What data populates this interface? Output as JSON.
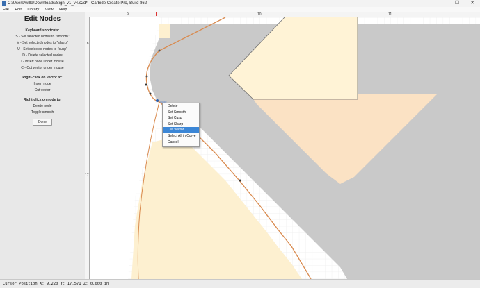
{
  "window": {
    "title": "C:/Users/willa/Downloads/Sign_v1_v4.c2d* - Carbide Create Pro, Build 862",
    "minimize_glyph": "—",
    "maximize_glyph": "☐",
    "close_glyph": "✕"
  },
  "menu": [
    "File",
    "Edit",
    "Library",
    "View",
    "Help"
  ],
  "panel": {
    "heading": "Edit Nodes",
    "shortcuts_title": "Keyboard shortcuts:",
    "shortcuts": [
      "S - Set selected nodes to \"smooth\"",
      "V - Set selected nodes to \"sharp\"",
      "U - Set selected nodes to \"cusp\"",
      "D - Delete selected nodes",
      "I - Insert node under mouse",
      "C - Cut vector under mouse"
    ],
    "vector_title": "Right-click on vector to:",
    "vector_actions": [
      "Insert node",
      "Cut vector"
    ],
    "node_title": "Right-click on node to:",
    "node_actions": [
      "Delete node",
      "Toggle smooth"
    ],
    "done_label": "Done"
  },
  "rulers": {
    "top_labels": [
      "9",
      "10",
      "11"
    ],
    "left_labels": [
      "18",
      "17"
    ]
  },
  "context_menu": {
    "items": [
      "Delete",
      "Set Smooth",
      "Set Cusp",
      "Set Sharp",
      "Cut Vector",
      "Select All in Curve",
      "Cancel"
    ],
    "selected_index": 4
  },
  "node_tag": "Node",
  "status": {
    "text": "Cursor Position X: 9.220 Y: 17.571 Z: 0.000 in"
  },
  "colors": {
    "accent_orange": "#d98a4e",
    "selection_blue": "#3b86d6",
    "gray_region": "#c9c9c9",
    "cream_region": "#fdf0d0"
  }
}
